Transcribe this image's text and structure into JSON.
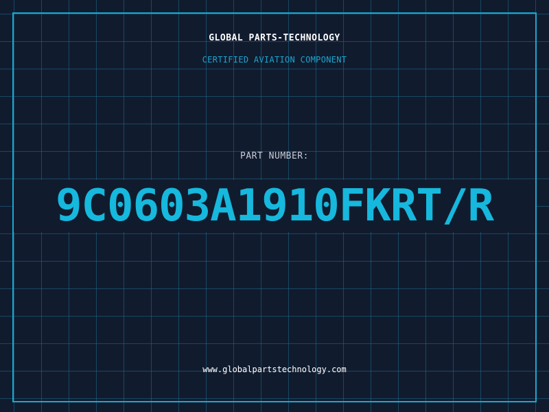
{
  "header": {
    "brand": "GLOBAL PARTS-TECHNOLOGY",
    "subtitle": "CERTIFIED AVIATION COMPONENT"
  },
  "part": {
    "label": "PART NUMBER:",
    "number": "9C0603A1910FKRT/R"
  },
  "footer": {
    "url": "www.globalpartstechnology.com"
  },
  "colors": {
    "background": "#111b2e",
    "grid": "#1e6e8c",
    "accent": "#16b8dd",
    "frame": "#17a9cf",
    "text": "#ffffff",
    "label": "#c7ccd6"
  }
}
